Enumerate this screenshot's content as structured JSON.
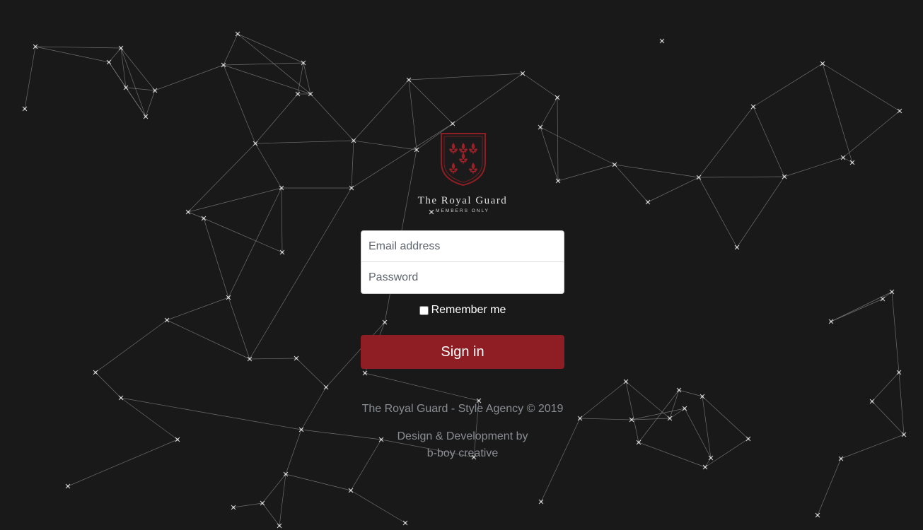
{
  "brand": {
    "title": "The Royal Guard",
    "subtitle": "MEMBERS ONLY",
    "crest_color": "#8e1e24",
    "crest_icon": "fleur-de-lis-crest"
  },
  "login": {
    "email_placeholder": "Email address",
    "password_placeholder": "Password",
    "remember_label": "Remember me",
    "remember_checked": false,
    "submit_label": "Sign in",
    "accent_color": "#8e1e24"
  },
  "footer": {
    "copyright": "The Royal Guard - Style Agency © 2019",
    "credit_line1": "Design & Development by",
    "credit_line2": "b-boy creative"
  },
  "background": {
    "color": "#191919",
    "style": "particle-network"
  }
}
